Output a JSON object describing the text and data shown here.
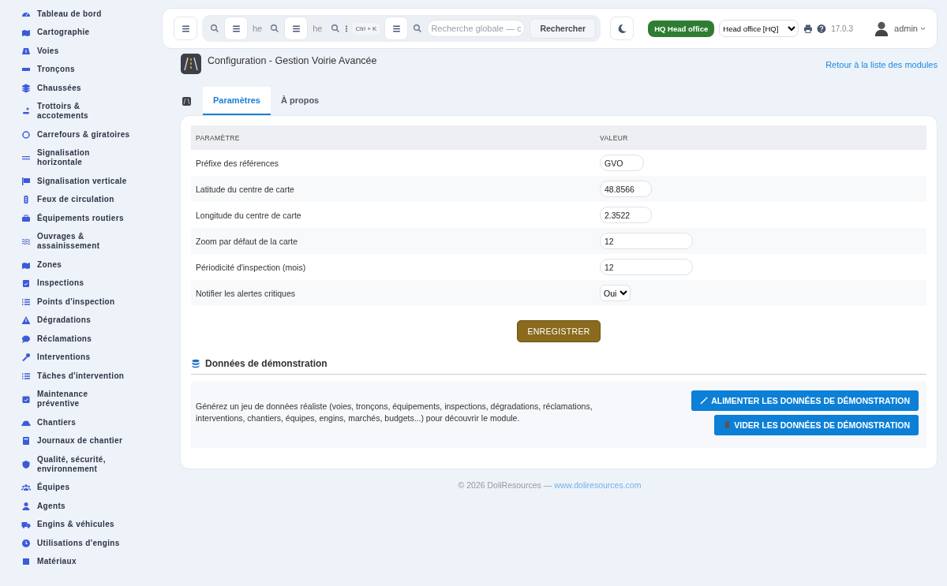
{
  "sidebar": {
    "items": [
      {
        "label": "Tableau de bord"
      },
      {
        "label": "Cartographie"
      },
      {
        "label": "Voies"
      },
      {
        "label": "Tronçons"
      },
      {
        "label": "Chaussées"
      },
      {
        "label": "Trottoirs & accotements"
      },
      {
        "label": "Carrefours & giratoires"
      },
      {
        "label": "Signalisation horizontale"
      },
      {
        "label": "Signalisation verticale"
      },
      {
        "label": "Feux de circulation"
      },
      {
        "label": "Équipements routiers"
      },
      {
        "label": "Ouvrages & assainissement"
      },
      {
        "label": "Zones"
      },
      {
        "label": "Inspections"
      },
      {
        "label": "Points d'inspection"
      },
      {
        "label": "Dégradations"
      },
      {
        "label": "Réclamations"
      },
      {
        "label": "Interventions"
      },
      {
        "label": "Tâches d'intervention"
      },
      {
        "label": "Maintenance préventive"
      },
      {
        "label": "Chantiers"
      },
      {
        "label": "Journaux de chantier"
      },
      {
        "label": "Qualité, sécurité, environnement"
      },
      {
        "label": "Équipes"
      },
      {
        "label": "Agents"
      },
      {
        "label": "Engins & véhicules"
      },
      {
        "label": "Utilisations d'engins"
      },
      {
        "label": "Matériaux"
      }
    ]
  },
  "topbar": {
    "ghost_texts": [
      "he",
      "he"
    ],
    "shortcut": "Ctrl + K",
    "search": {
      "placeholder": "Recherche globale — c"
    },
    "search_button": "Rechercher",
    "entity_badge": "HQ Head office",
    "entity_select": "Head office [HQ]",
    "version": "17.0.3",
    "user": "admin"
  },
  "header": {
    "title": "Configuration - Gestion Voirie Avancée",
    "back_link": "Retour à la liste des modules"
  },
  "tabs": [
    {
      "label": "Paramètres",
      "selected": true
    },
    {
      "label": "À propos",
      "selected": false
    }
  ],
  "table": {
    "columns": [
      "PARAMÈTRE",
      "VALEUR"
    ],
    "rows": [
      {
        "label": "Préfixe des références",
        "kind": "text",
        "value": "GVO"
      },
      {
        "label": "Latitude du centre de carte",
        "kind": "text",
        "value": "48.8566"
      },
      {
        "label": "Longitude du centre de carte",
        "kind": "text",
        "value": "2.3522"
      },
      {
        "label": "Zoom par défaut de la carte",
        "kind": "text",
        "value": "12"
      },
      {
        "label": "Périodicité d'inspection (mois)",
        "kind": "text",
        "value": "12"
      },
      {
        "label": "Notifier les alertes critiques",
        "kind": "select",
        "value": "Oui"
      }
    ]
  },
  "save_button": "ENREGISTRER",
  "demo": {
    "title": "Données de démonstration",
    "description": "Générez un jeu de données réaliste (voies, tronçons, équipements, inspections, dégradations, réclamations, interventions, chantiers, équipes, engins, marchés, budgets...) pour découvrir le module.",
    "buttons": [
      {
        "label": "ALIMENTER LES DONNÉES DE DÉMONSTRATION"
      },
      {
        "label": "VIDER LES DONNÉES DE DÉMONSTRATION"
      }
    ]
  },
  "footer": {
    "text": "© 2026 DoliResources — ",
    "link": "www.doliresources.com"
  }
}
